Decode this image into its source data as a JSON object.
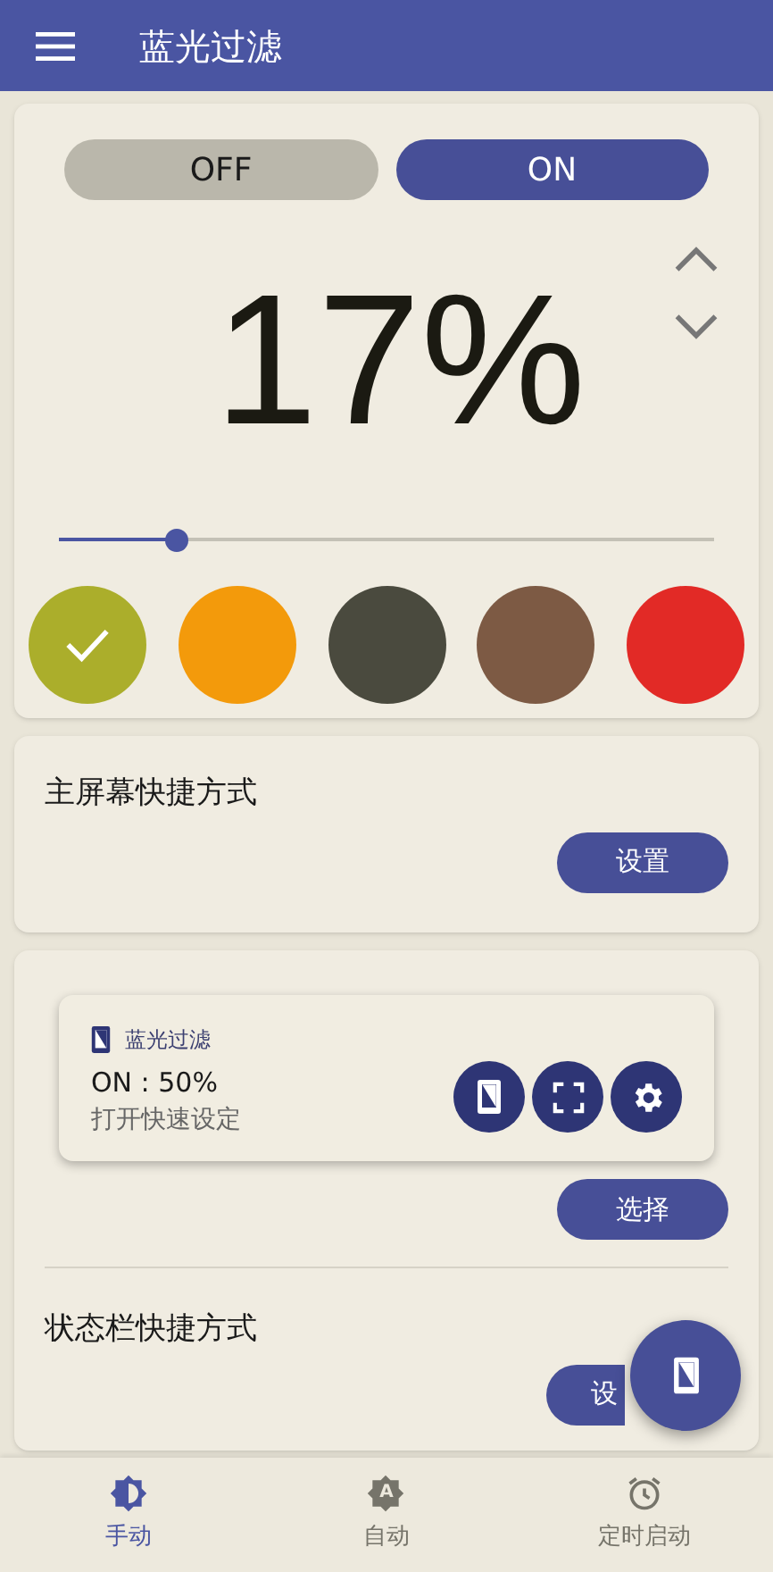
{
  "app_bar": {
    "title": "蓝光过滤"
  },
  "power": [
    {
      "label": "OFF",
      "selected": false
    },
    {
      "label": "ON",
      "selected": true
    }
  ],
  "intensity": {
    "reading": "17%",
    "level": 0.18
  },
  "colors": [
    {
      "color": "#abae2b",
      "selected": true
    },
    {
      "color": "#f39a0b",
      "selected": false
    },
    {
      "color": "#4a4a3e",
      "selected": false
    },
    {
      "color": "#7d5a44",
      "selected": false
    },
    {
      "color": "#e22a26",
      "selected": false
    }
  ],
  "home_shortcut": {
    "title": "主屏幕快捷方式",
    "button": "设置"
  },
  "notification_preview": {
    "app": "蓝光过滤",
    "status": "ON : 50%",
    "subtitle": "打开快速设定",
    "select_button": "选择"
  },
  "statusbar_shortcut": {
    "title": "状态栏快捷方式",
    "button": "设"
  },
  "bottom_nav": [
    {
      "kind": "manual",
      "label": "手动",
      "selected": true
    },
    {
      "kind": "auto",
      "label": "自动",
      "icon_text": "A",
      "selected": false
    },
    {
      "kind": "timer",
      "label": "定时启动",
      "selected": false
    }
  ]
}
